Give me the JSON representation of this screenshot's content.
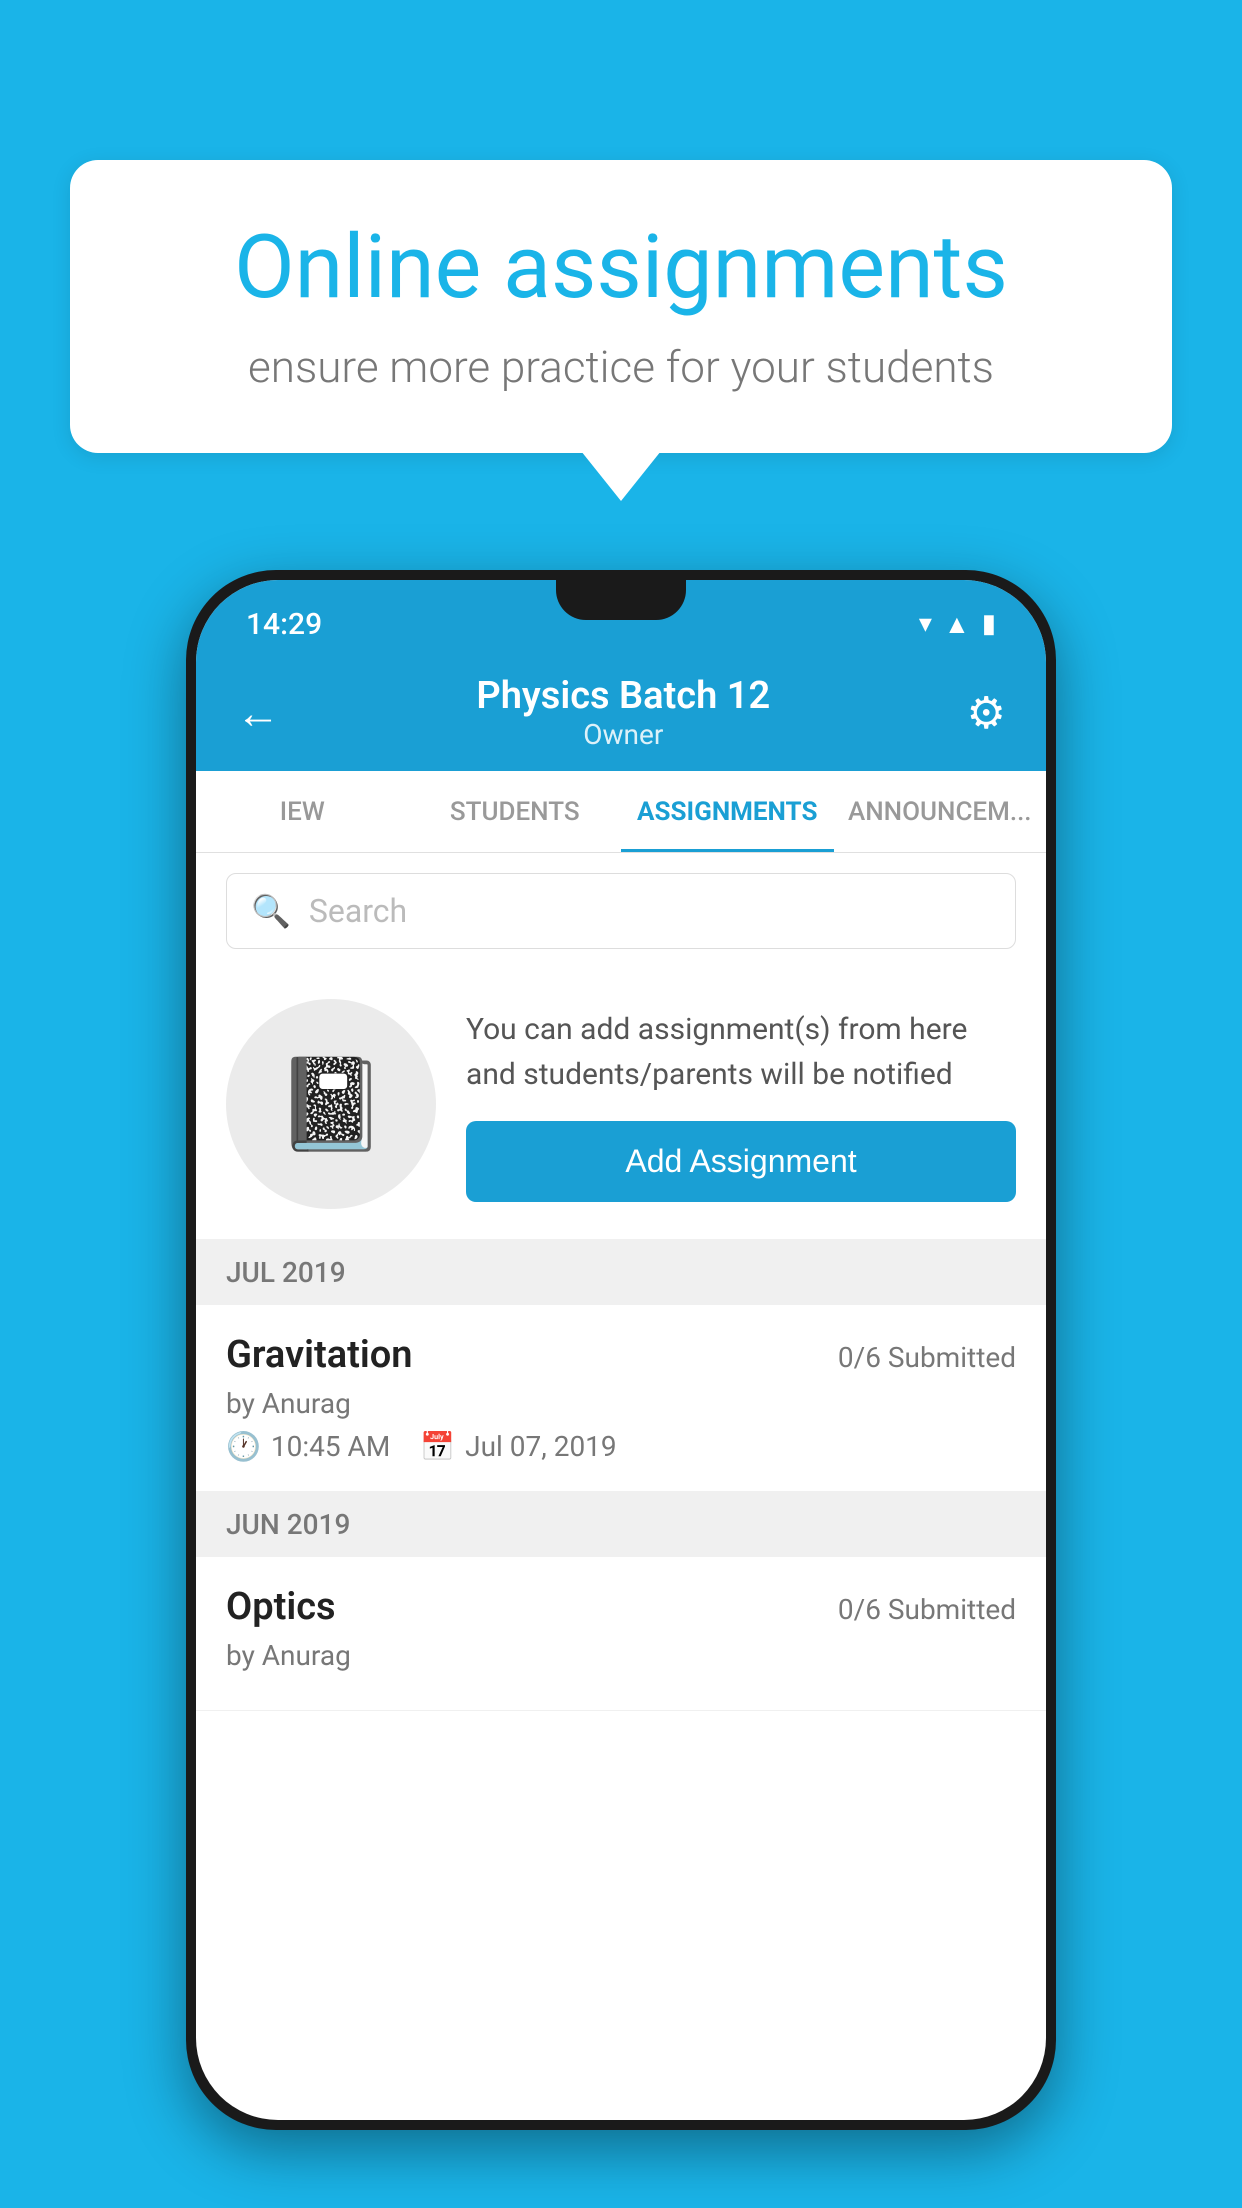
{
  "background": {
    "color": "#1ab4e8"
  },
  "speech_bubble": {
    "title": "Online assignments",
    "subtitle": "ensure more practice for your students"
  },
  "phone": {
    "status_bar": {
      "time": "14:29"
    },
    "header": {
      "title": "Physics Batch 12",
      "subtitle": "Owner",
      "back_label": "←",
      "gear_label": "⚙"
    },
    "tabs": [
      {
        "label": "IEW",
        "active": false
      },
      {
        "label": "STUDENTS",
        "active": false
      },
      {
        "label": "ASSIGNMENTS",
        "active": true
      },
      {
        "label": "ANNOUNCEM...",
        "active": false
      }
    ],
    "search": {
      "placeholder": "Search"
    },
    "promo": {
      "text": "You can add assignment(s) from here and students/parents will be notified",
      "button_label": "Add Assignment"
    },
    "sections": [
      {
        "label": "JUL 2019",
        "assignments": [
          {
            "name": "Gravitation",
            "submitted": "0/6 Submitted",
            "by": "by Anurag",
            "time": "10:45 AM",
            "date": "Jul 07, 2019"
          }
        ]
      },
      {
        "label": "JUN 2019",
        "assignments": [
          {
            "name": "Optics",
            "submitted": "0/6 Submitted",
            "by": "by Anurag",
            "time": "",
            "date": ""
          }
        ]
      }
    ]
  }
}
